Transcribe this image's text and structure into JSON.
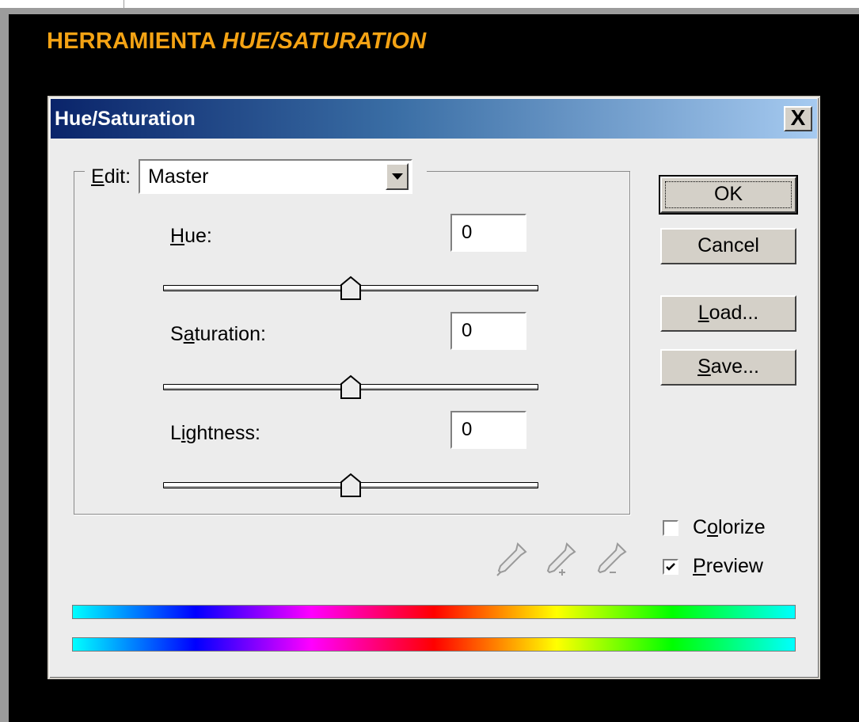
{
  "heading": {
    "main": "HERRAMIENTA ",
    "italic": "HUE/SATURATION"
  },
  "dialog": {
    "title": "Hue/Saturation",
    "close_glyph": "X",
    "edit": {
      "label_ul": "E",
      "label_rest": "dit:",
      "selected": "Master"
    },
    "hue": {
      "label_ul": "H",
      "label_rest": "ue:",
      "value": "0",
      "slider_fraction": 0.5
    },
    "saturation": {
      "label_pre": "S",
      "label_ul": "a",
      "label_rest": "turation:",
      "value": "0",
      "slider_fraction": 0.5
    },
    "lightness": {
      "label_pre": "L",
      "label_ul": "i",
      "label_rest": "ghtness:",
      "value": "0",
      "slider_fraction": 0.5
    },
    "buttons": {
      "ok": "OK",
      "cancel": "Cancel",
      "load_ul": "L",
      "load_rest": "oad...",
      "save_ul": "S",
      "save_rest": "ave..."
    },
    "colorize": {
      "pre": "C",
      "ul": "o",
      "rest": "lorize",
      "checked": false
    },
    "preview": {
      "ul": "P",
      "rest": "review",
      "checked": true
    },
    "icons": [
      "eyedropper-icon",
      "eyedropper-plus-icon",
      "eyedropper-minus-icon"
    ]
  }
}
